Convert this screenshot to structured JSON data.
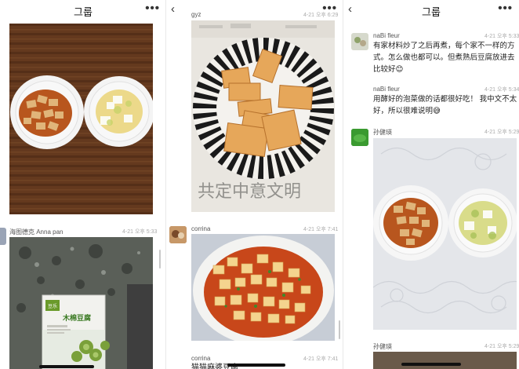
{
  "panel1": {
    "title": "그룹",
    "more": "•••",
    "post2": {
      "author": "海图德克 Anna pan",
      "time": "4-21 오후 5:33"
    }
  },
  "panel2": {
    "back": "‹",
    "more": "•••",
    "post1": {
      "author": "gyz",
      "time": "4-21 오후 6:29"
    },
    "post2": {
      "author": "corrina",
      "time": "4-21 오후 7:41"
    },
    "post3": {
      "author": "corrina",
      "time": "4-21 오후 7:41",
      "text": "猫猫麻婆豆腐"
    },
    "plate_text": "共定中意文明"
  },
  "panel3": {
    "title": "그룹",
    "back": "‹",
    "more": "•••",
    "msg1": {
      "author": "naBi fleur",
      "time": "4-21 오후 5:33",
      "text": "有家材料炒了之后再煮，每个家不一样的方式。怎么做也都可以。但煮熟后豆腐放进去比较好😊"
    },
    "msg2": {
      "author": "naBi fleur",
      "time": "4-21 오후 5:34",
      "text": "用酵好的泡菜做的话都很好吃！ 我中文不太好，所以很难说明😅"
    },
    "msg3": {
      "author": "孙健瑛",
      "time": "4-21 오후 5:29"
    },
    "msg4": {
      "author": "孙健瑛",
      "time": "4-21 오후 5:29"
    }
  },
  "package": {
    "brand": "木棉豆腐",
    "logo": "豆乐"
  },
  "colors": {
    "wood": "#6b3f22",
    "sauce": "#b8561e",
    "tofu": "#e8c98a",
    "stripe": "#1a1a1a"
  }
}
